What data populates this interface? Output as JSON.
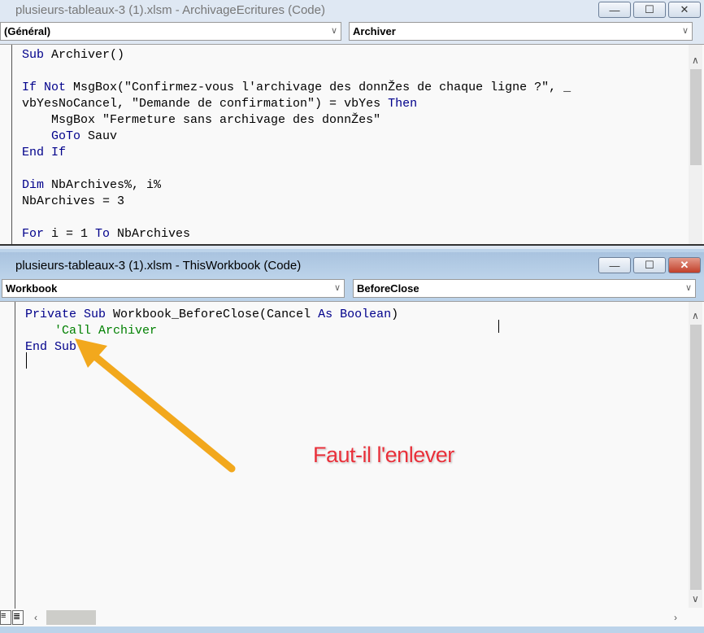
{
  "top_window": {
    "title": "plusieurs-tableaux-3 (1).xlsm - ArchivageEcritures (Code)",
    "object_combo": "(Général)",
    "proc_combo": "Archiver",
    "lines": [
      [
        [
          "Sub",
          "kw"
        ],
        [
          " Archiver()",
          ""
        ]
      ],
      [],
      [
        [
          "If Not",
          "kw"
        ],
        [
          " MsgBox(\"Confirmez-vous l'archivage des donnŽes de chaque ligne ?\", _",
          ""
        ]
      ],
      [
        [
          "vbYesNoCancel, \"Demande de confirmation\") = vbYes ",
          ""
        ],
        [
          "Then",
          "kw"
        ]
      ],
      [
        [
          "    MsgBox \"Fermeture sans archivage des donnŽes\"",
          ""
        ]
      ],
      [
        [
          "    ",
          ""
        ],
        [
          "GoTo",
          "kw"
        ],
        [
          " Sauv",
          ""
        ]
      ],
      [
        [
          "End If",
          "kw"
        ]
      ],
      [],
      [
        [
          "Dim",
          "kw"
        ],
        [
          " NbArchives%, i%",
          ""
        ]
      ],
      [
        [
          "NbArchives = 3",
          ""
        ]
      ],
      [],
      [
        [
          "For",
          "kw"
        ],
        [
          " i = 1 ",
          ""
        ],
        [
          "To",
          "kw"
        ],
        [
          " NbArchives",
          ""
        ]
      ]
    ]
  },
  "bottom_window": {
    "title": "plusieurs-tableaux-3 (1).xlsm - ThisWorkbook (Code)",
    "object_combo": "Workbook",
    "proc_combo": "BeforeClose",
    "lines": [
      [
        [
          "Private Sub",
          "kw"
        ],
        [
          " Workbook_BeforeClose(Cancel ",
          ""
        ],
        [
          "As Boolean",
          "kw"
        ],
        [
          ")",
          ""
        ]
      ],
      [
        [
          "    'Call Archiver",
          "cm"
        ]
      ],
      [
        [
          "End Sub",
          "kw"
        ]
      ]
    ]
  },
  "annotation": {
    "text": "Faut-il l'enlever",
    "color": "#e8303a",
    "arrow_color": "#f2a81d"
  },
  "window_buttons": {
    "minimize": "—",
    "maximize": "☐",
    "close": "✕"
  },
  "chevron": "∨"
}
